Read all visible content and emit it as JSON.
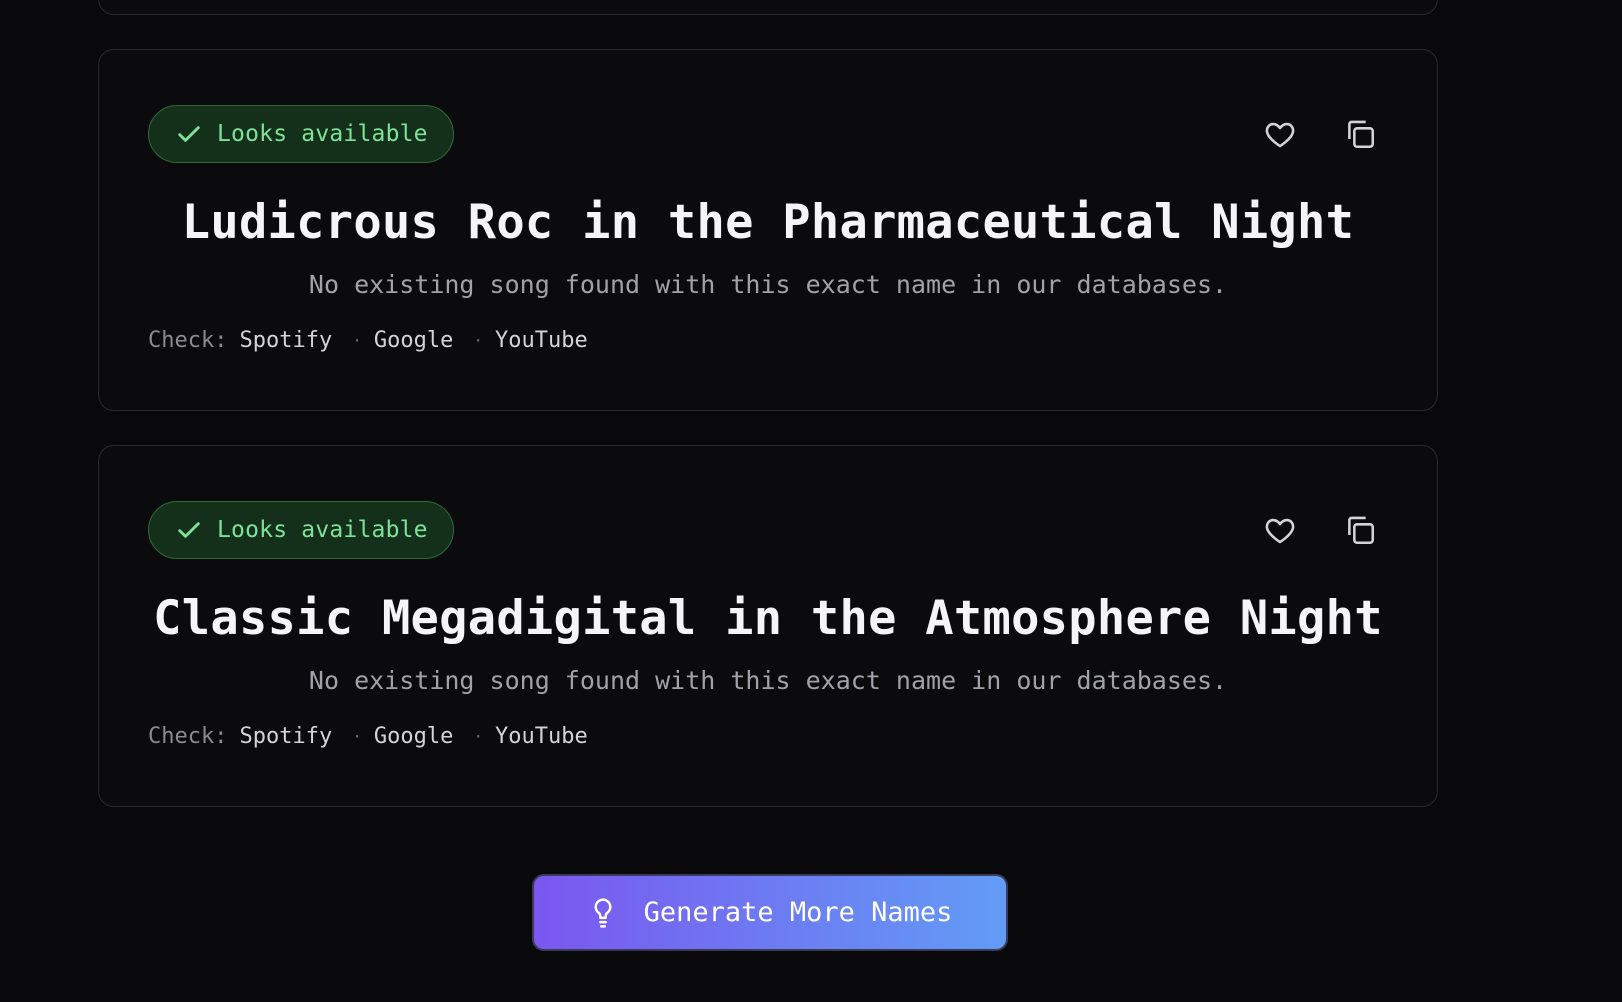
{
  "results": [
    {
      "status": "Looks available",
      "title": "Ludicrous Roc in the Pharmaceutical Night",
      "description": "No existing song found with this exact name in our databases.",
      "check_label": "Check:",
      "links": [
        "Spotify",
        "Google",
        "YouTube"
      ],
      "separator": "·"
    },
    {
      "status": "Looks available",
      "title": "Classic Megadigital in the Atmosphere Night",
      "description": "No existing song found with this exact name in our databases.",
      "check_label": "Check:",
      "links": [
        "Spotify",
        "Google",
        "YouTube"
      ],
      "separator": "·"
    }
  ],
  "actions": {
    "generate_more_label": "Generate More Names"
  },
  "icons": {
    "status": "check-icon",
    "favorite": "heart-icon",
    "copy": "copy-icon",
    "generate": "lightbulb-icon"
  },
  "colors": {
    "background": "#09090b",
    "available_text": "#7ee39a",
    "available_bg": "#14301b",
    "button_gradient_start": "#7b57f0",
    "button_gradient_end": "#629cf6"
  }
}
